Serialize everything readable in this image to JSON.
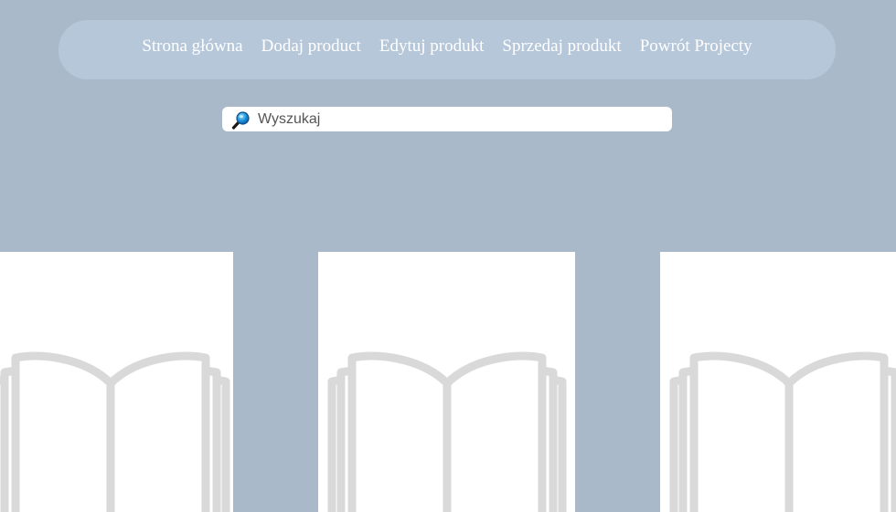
{
  "nav": {
    "items": [
      {
        "label": "Strona główna"
      },
      {
        "label": "Dodaj product"
      },
      {
        "label": "Edytuj produkt"
      },
      {
        "label": "Sprzedaj produkt"
      },
      {
        "label": "Powrót Projecty"
      }
    ]
  },
  "search": {
    "placeholder": "Wyszukaj",
    "value": "",
    "icon": "magnifier-icon"
  },
  "products": [
    {
      "image": "book-placeholder-icon"
    },
    {
      "image": "book-placeholder-icon"
    },
    {
      "image": "book-placeholder-icon"
    }
  ],
  "colors": {
    "background": "#a9b9ca",
    "nav_background": "#b6c7d9",
    "nav_text": "#ffffff",
    "card_background": "#ffffff",
    "book_icon": "#d9d9d9"
  }
}
